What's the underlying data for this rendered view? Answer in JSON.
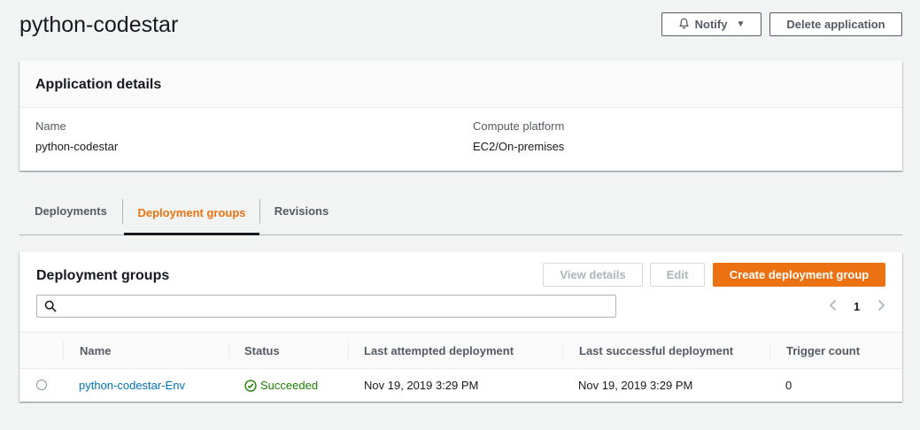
{
  "header": {
    "title": "python-codestar",
    "notify_label": "Notify",
    "delete_label": "Delete application"
  },
  "details": {
    "heading": "Application details",
    "name_key": "Name",
    "name_value": "python-codestar",
    "platform_key": "Compute platform",
    "platform_value": "EC2/On-premises"
  },
  "tabs": [
    {
      "label": "Deployments",
      "active": false
    },
    {
      "label": "Deployment groups",
      "active": true
    },
    {
      "label": "Revisions",
      "active": false
    }
  ],
  "groups": {
    "heading": "Deployment groups",
    "view_details_label": "View details",
    "edit_label": "Edit",
    "create_label": "Create deployment group",
    "search_placeholder": "",
    "page": "1",
    "columns": [
      "Name",
      "Status",
      "Last attempted deployment",
      "Last successful deployment",
      "Trigger count"
    ],
    "rows": [
      {
        "name": "python-codestar-Env",
        "status": "Succeeded",
        "last_attempted": "Nov 19, 2019 3:29 PM",
        "last_successful": "Nov 19, 2019 3:29 PM",
        "trigger_count": "0"
      }
    ]
  },
  "colors": {
    "accent": "#ec7211",
    "link": "#0073bb",
    "success": "#1d8102"
  },
  "icons": {
    "notify": "bell-icon",
    "search": "search-icon",
    "status": "check-circle-icon"
  }
}
